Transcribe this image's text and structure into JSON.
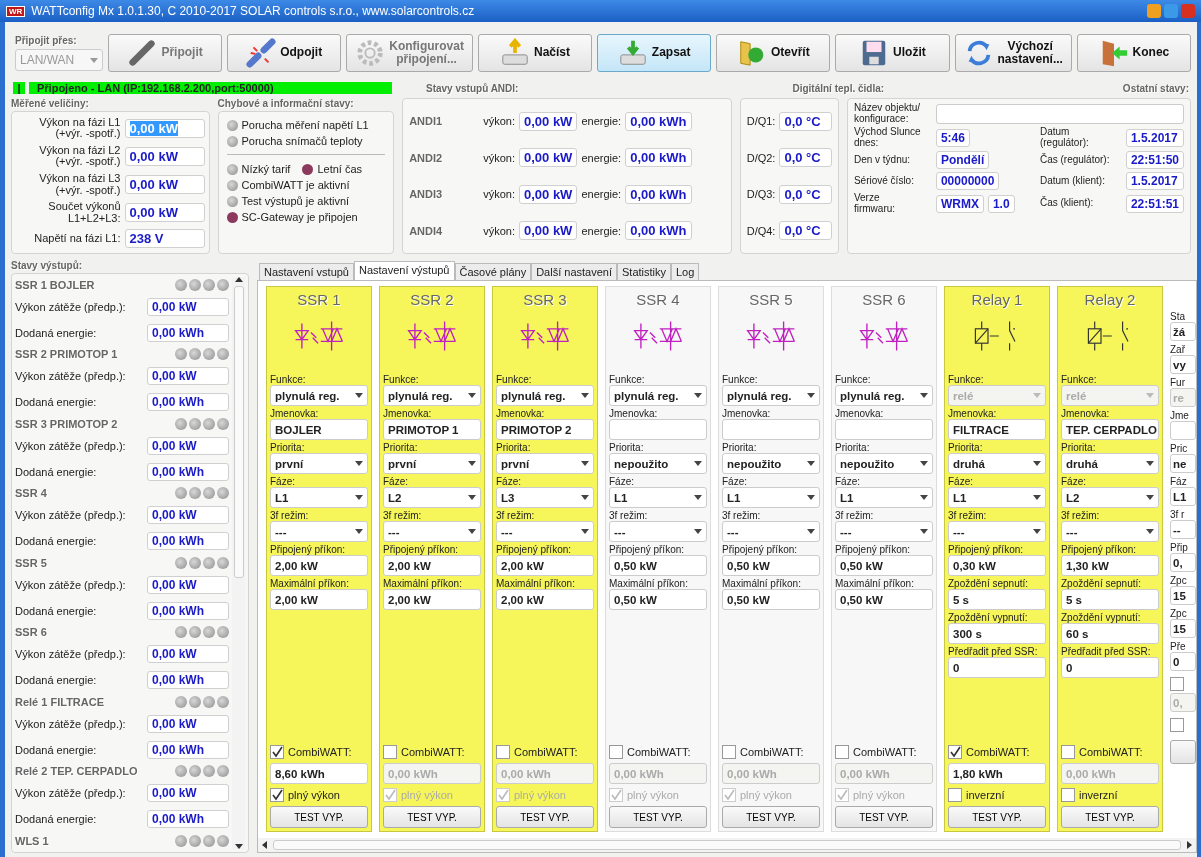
{
  "window": {
    "logo": "WR",
    "title": "WATTconfig Mx 1.0.1.30, C 2010-2017 SOLAR controls s.r.o., www.solarcontrols.cz"
  },
  "connection": {
    "label": "Připojit přes:",
    "value": "LAN/WAN",
    "disabled": true
  },
  "toolbar": [
    {
      "kind": "connect",
      "label": "Připojit",
      "disabled": true,
      "selected": false
    },
    {
      "kind": "disconnect",
      "label": "Odpojit",
      "disabled": false,
      "selected": false
    },
    {
      "kind": "configure",
      "label": "Konfigurovat\npřipojení...",
      "disabled": true,
      "selected": false
    },
    {
      "kind": "load",
      "label": "Načíst",
      "disabled": false,
      "selected": false
    },
    {
      "kind": "write",
      "label": "Zapsat",
      "disabled": false,
      "selected": true
    },
    {
      "kind": "open",
      "label": "Otevřít",
      "disabled": false,
      "selected": false
    },
    {
      "kind": "save",
      "label": "Uložit",
      "disabled": false,
      "selected": false
    },
    {
      "kind": "reset",
      "label": "Výchozí\nnastavení...",
      "disabled": false,
      "selected": false
    },
    {
      "kind": "exit",
      "label": "Konec",
      "disabled": false,
      "selected": false
    }
  ],
  "status": {
    "indicator": "|",
    "text": "Připojeno - LAN (IP:192.168.2.200,port:50000)",
    "connected": true
  },
  "measured": {
    "title": "Měřené veličiny:",
    "rows": [
      {
        "label": "Výkon na fázi L1\n(+výr. -spotř.)",
        "value": "0,00 kW",
        "selected": true
      },
      {
        "label": "Výkon na fázi L2\n(+výr. -spotř.)",
        "value": "0,00 kW",
        "selected": false
      },
      {
        "label": "Výkon na fázi L3\n(+výr. -spotř.)",
        "value": "0,00 kW",
        "selected": false
      },
      {
        "label": "Součet výkonů\nL1+L2+L3:",
        "value": "0,00 kW",
        "selected": false
      },
      {
        "label": "Napětí na fázi L1:",
        "value": "238 V",
        "selected": false
      }
    ]
  },
  "info": {
    "title": "Chybové a informační stavy:",
    "rows": [
      {
        "divider_before": false,
        "items": [
          {
            "label": "Porucha měření napětí L1",
            "on": false
          }
        ]
      },
      {
        "divider_before": false,
        "items": [
          {
            "label": "Porucha snímačů teploty",
            "on": false
          }
        ]
      },
      {
        "divider_before": true,
        "items": [
          {
            "label": "Nízký tarif",
            "on": false
          },
          {
            "label": "Letní čas",
            "on": true
          }
        ]
      },
      {
        "divider_before": false,
        "items": [
          {
            "label": "CombiWATT je aktivní",
            "on": false
          }
        ]
      },
      {
        "divider_before": false,
        "items": [
          {
            "label": "Test výstupů je aktivní",
            "on": false
          }
        ]
      },
      {
        "divider_before": false,
        "items": [
          {
            "label": "SC-Gateway je připojen",
            "on": true
          }
        ]
      }
    ]
  },
  "andi": {
    "title": "Stavy vstupů ANDI:",
    "rows": [
      {
        "name": "ANDI1",
        "power_label": "výkon:",
        "power": "0,00 kW",
        "energy_label": "energie:",
        "energy": "0,00 kWh"
      },
      {
        "name": "ANDI2",
        "power_label": "výkon:",
        "power": "0,00 kW",
        "energy_label": "energie:",
        "energy": "0,00 kWh"
      },
      {
        "name": "ANDI3",
        "power_label": "výkon:",
        "power": "0,00 kW",
        "energy_label": "energie:",
        "energy": "0,00 kWh"
      },
      {
        "name": "ANDI4",
        "power_label": "výkon:",
        "power": "0,00 kW",
        "energy_label": "energie:",
        "energy": "0,00 kWh"
      }
    ]
  },
  "temps": {
    "title": "Digitální tepl. čidla:",
    "rows": [
      {
        "label": "D/Q1:",
        "value": "0,0 °C"
      },
      {
        "label": "D/Q2:",
        "value": "0,0 °C"
      },
      {
        "label": "D/Q3:",
        "value": "0,0 °C"
      },
      {
        "label": "D/Q4:",
        "value": "0,0 °C"
      }
    ]
  },
  "other": {
    "title": "Ostatní stavy:",
    "name_label": "Název objektu/\nkonfigurace:",
    "rows": [
      {
        "left_label": "Východ Slunce\ndnes:",
        "left_values": [
          "5:46"
        ],
        "right_label": "Datum\n(regulátor):",
        "right_value": "1.5.2017"
      },
      {
        "left_label": "Den v týdnu:",
        "left_values": [
          "Pondělí"
        ],
        "right_label": "Čas (regulátor):",
        "right_value": "22:51:50"
      },
      {
        "left_label": "Sériové číslo:",
        "left_values": [
          "00000000"
        ],
        "right_label": "Datum (klient):",
        "right_value": "1.5.2017"
      },
      {
        "left_label": "Verze\nfirmwaru:",
        "left_values": [
          "WRMX",
          "1.0"
        ],
        "right_label": "Čas (klient):",
        "right_value": "22:51:51"
      }
    ]
  },
  "outputs_panel": {
    "title": "Stavy výstupů:",
    "items": [
      {
        "name": "SSR 1 BOJLER",
        "leds": [
          {
            "on": false
          },
          {
            "on": false
          },
          {
            "on": false
          },
          {
            "on": false
          }
        ],
        "rows": [
          {
            "label": "Výkon zátěže (předp.):",
            "value": "0,00 kW"
          },
          {
            "label": "Dodaná energie:",
            "value": "0,00 kWh"
          }
        ]
      },
      {
        "name": "SSR 2 PRIMOTOP 1",
        "leds": [
          {
            "on": false
          },
          {
            "on": false
          },
          {
            "on": false
          },
          {
            "on": false
          }
        ],
        "rows": [
          {
            "label": "Výkon zátěže (předp.):",
            "value": "0,00 kW"
          },
          {
            "label": "Dodaná energie:",
            "value": "0,00 kWh"
          }
        ]
      },
      {
        "name": "SSR 3 PRIMOTOP 2",
        "leds": [
          {
            "on": false
          },
          {
            "on": false
          },
          {
            "on": false
          },
          {
            "on": false
          }
        ],
        "rows": [
          {
            "label": "Výkon zátěže (předp.):",
            "value": "0,00 kW"
          },
          {
            "label": "Dodaná energie:",
            "value": "0,00 kWh"
          }
        ]
      },
      {
        "name": "SSR 4",
        "leds": [
          {
            "on": false
          },
          {
            "on": false
          },
          {
            "on": false
          },
          {
            "on": false
          }
        ],
        "rows": [
          {
            "label": "Výkon zátěže (předp.):",
            "value": "0,00 kW"
          },
          {
            "label": "Dodaná energie:",
            "value": "0,00 kWh"
          }
        ]
      },
      {
        "name": "SSR 5",
        "leds": [
          {
            "on": false
          },
          {
            "on": false
          },
          {
            "on": false
          },
          {
            "on": false
          }
        ],
        "rows": [
          {
            "label": "Výkon zátěže (předp.):",
            "value": "0,00 kW"
          },
          {
            "label": "Dodaná energie:",
            "value": "0,00 kWh"
          }
        ]
      },
      {
        "name": "SSR 6",
        "leds": [
          {
            "on": false
          },
          {
            "on": false
          },
          {
            "on": false
          },
          {
            "on": false
          }
        ],
        "rows": [
          {
            "label": "Výkon zátěže (předp.):",
            "value": "0,00 kW"
          },
          {
            "label": "Dodaná energie:",
            "value": "0,00 kWh"
          }
        ]
      },
      {
        "name": "Relé 1 FILTRACE",
        "leds": [
          {
            "on": false
          },
          {
            "on": false
          },
          {
            "on": false
          },
          {
            "on": false
          }
        ],
        "rows": [
          {
            "label": "Výkon zátěže (předp.):",
            "value": "0,00 kW"
          },
          {
            "label": "Dodaná energie:",
            "value": "0,00 kWh"
          }
        ]
      },
      {
        "name": "Relé 2 TEP. CERPADLO",
        "leds": [
          {
            "on": false
          },
          {
            "on": false
          },
          {
            "on": false
          },
          {
            "on": false
          }
        ],
        "rows": [
          {
            "label": "Výkon zátěže (předp.):",
            "value": "0,00 kW"
          },
          {
            "label": "Dodaná energie:",
            "value": "0,00 kWh"
          }
        ]
      },
      {
        "name": "WLS 1",
        "leds": [
          {
            "on": false
          },
          {
            "on": false
          },
          {
            "on": false
          },
          {
            "on": false
          }
        ]
      }
    ]
  },
  "tabs": [
    {
      "label": "Nastavení vstupů",
      "selected": false
    },
    {
      "label": "Nastavení výstupů",
      "selected": true
    },
    {
      "label": "Časové plány",
      "selected": false
    },
    {
      "label": "Další nastavení",
      "selected": false
    },
    {
      "label": "Statistiky",
      "selected": false
    },
    {
      "label": "Log",
      "selected": false
    }
  ],
  "columns": [
    {
      "title": "SSR 1",
      "kind": "ssr",
      "highlighted": true,
      "fields": [
        {
          "kind": "select",
          "label": "Funkce:",
          "value": "plynulá reg.",
          "disabled": false
        },
        {
          "kind": "input",
          "label": "Jmenovka:",
          "value": "BOJLER",
          "disabled": false
        },
        {
          "kind": "select",
          "label": "Priorita:",
          "value": "první",
          "disabled": false
        },
        {
          "kind": "select",
          "label": "Fáze:",
          "value": "L1",
          "disabled": false
        },
        {
          "kind": "select",
          "label": "3f režim:",
          "value": "---",
          "disabled": false
        },
        {
          "kind": "input",
          "label": "Připojený příkon:",
          "value": "2,00 kW",
          "disabled": false
        },
        {
          "kind": "input",
          "label": "Maximální příkon:",
          "value": "2,00 kW",
          "disabled": false
        }
      ],
      "combi": {
        "label": "CombiWATT:",
        "checked": true,
        "value": "8,60 kWh",
        "disabled": false
      },
      "option": {
        "label": "plný výkon",
        "checked": true,
        "disabled": false
      },
      "button": "TEST VYP."
    },
    {
      "title": "SSR 2",
      "kind": "ssr",
      "highlighted": true,
      "fields": [
        {
          "kind": "select",
          "label": "Funkce:",
          "value": "plynulá reg.",
          "disabled": false
        },
        {
          "kind": "input",
          "label": "Jmenovka:",
          "value": "PRIMOTOP 1",
          "disabled": false
        },
        {
          "kind": "select",
          "label": "Priorita:",
          "value": "první",
          "disabled": false
        },
        {
          "kind": "select",
          "label": "Fáze:",
          "value": "L2",
          "disabled": false
        },
        {
          "kind": "select",
          "label": "3f režim:",
          "value": "---",
          "disabled": false
        },
        {
          "kind": "input",
          "label": "Připojený příkon:",
          "value": "2,00 kW",
          "disabled": false
        },
        {
          "kind": "input",
          "label": "Maximální příkon:",
          "value": "2,00 kW",
          "disabled": false
        }
      ],
      "combi": {
        "label": "CombiWATT:",
        "checked": false,
        "value": "0,00 kWh",
        "disabled": true
      },
      "option": {
        "label": "plný výkon",
        "checked": true,
        "disabled": true
      },
      "button": "TEST VYP."
    },
    {
      "title": "SSR 3",
      "kind": "ssr",
      "highlighted": true,
      "fields": [
        {
          "kind": "select",
          "label": "Funkce:",
          "value": "plynulá reg.",
          "disabled": false
        },
        {
          "kind": "input",
          "label": "Jmenovka:",
          "value": "PRIMOTOP 2",
          "disabled": false
        },
        {
          "kind": "select",
          "label": "Priorita:",
          "value": "první",
          "disabled": false
        },
        {
          "kind": "select",
          "label": "Fáze:",
          "value": "L3",
          "disabled": false
        },
        {
          "kind": "select",
          "label": "3f režim:",
          "value": "---",
          "disabled": false
        },
        {
          "kind": "input",
          "label": "Připojený příkon:",
          "value": "2,00 kW",
          "disabled": false
        },
        {
          "kind": "input",
          "label": "Maximální příkon:",
          "value": "2,00 kW",
          "disabled": false
        }
      ],
      "combi": {
        "label": "CombiWATT:",
        "checked": false,
        "value": "0,00 kWh",
        "disabled": true
      },
      "option": {
        "label": "plný výkon",
        "checked": true,
        "disabled": true
      },
      "button": "TEST VYP."
    },
    {
      "title": "SSR 4",
      "kind": "ssr",
      "highlighted": false,
      "fields": [
        {
          "kind": "select",
          "label": "Funkce:",
          "value": "plynulá reg.",
          "disabled": false
        },
        {
          "kind": "input",
          "label": "Jmenovka:",
          "disabled": false
        },
        {
          "kind": "select",
          "label": "Priorita:",
          "value": "nepoužito",
          "disabled": false
        },
        {
          "kind": "select",
          "label": "Fáze:",
          "value": "L1",
          "disabled": false
        },
        {
          "kind": "select",
          "label": "3f režim:",
          "value": "---",
          "disabled": false
        },
        {
          "kind": "input",
          "label": "Připojený příkon:",
          "value": "0,50 kW",
          "disabled": false
        },
        {
          "kind": "input",
          "label": "Maximální příkon:",
          "value": "0,50 kW",
          "disabled": false
        }
      ],
      "combi": {
        "label": "CombiWATT:",
        "checked": false,
        "value": "0,00 kWh",
        "disabled": true
      },
      "option": {
        "label": "plný výkon",
        "checked": true,
        "disabled": true
      },
      "button": "TEST VYP."
    },
    {
      "title": "SSR 5",
      "kind": "ssr",
      "highlighted": false,
      "fields": [
        {
          "kind": "select",
          "label": "Funkce:",
          "value": "plynulá reg.",
          "disabled": false
        },
        {
          "kind": "input",
          "label": "Jmenovka:",
          "disabled": false
        },
        {
          "kind": "select",
          "label": "Priorita:",
          "value": "nepoužito",
          "disabled": false
        },
        {
          "kind": "select",
          "label": "Fáze:",
          "value": "L1",
          "disabled": false
        },
        {
          "kind": "select",
          "label": "3f režim:",
          "value": "---",
          "disabled": false
        },
        {
          "kind": "input",
          "label": "Připojený příkon:",
          "value": "0,50 kW",
          "disabled": false
        },
        {
          "kind": "input",
          "label": "Maximální příkon:",
          "value": "0,50 kW",
          "disabled": false
        }
      ],
      "combi": {
        "label": "CombiWATT:",
        "checked": false,
        "value": "0,00 kWh",
        "disabled": true
      },
      "option": {
        "label": "plný výkon",
        "checked": true,
        "disabled": true
      },
      "button": "TEST VYP."
    },
    {
      "title": "SSR 6",
      "kind": "ssr",
      "highlighted": false,
      "fields": [
        {
          "kind": "select",
          "label": "Funkce:",
          "value": "plynulá reg.",
          "disabled": false
        },
        {
          "kind": "input",
          "label": "Jmenovka:",
          "disabled": false
        },
        {
          "kind": "select",
          "label": "Priorita:",
          "value": "nepoužito",
          "disabled": false
        },
        {
          "kind": "select",
          "label": "Fáze:",
          "value": "L1",
          "disabled": false
        },
        {
          "kind": "select",
          "label": "3f režim:",
          "value": "---",
          "disabled": false
        },
        {
          "kind": "input",
          "label": "Připojený příkon:",
          "value": "0,50 kW",
          "disabled": false
        },
        {
          "kind": "input",
          "label": "Maximální příkon:",
          "value": "0,50 kW",
          "disabled": false
        }
      ],
      "combi": {
        "label": "CombiWATT:",
        "checked": false,
        "value": "0,00 kWh",
        "disabled": true
      },
      "option": {
        "label": "plný výkon",
        "checked": true,
        "disabled": true
      },
      "button": "TEST VYP."
    },
    {
      "title": "Relay 1",
      "kind": "relay",
      "highlighted": true,
      "fields": [
        {
          "kind": "select",
          "label": "Funkce:",
          "value": "relé",
          "disabled": true
        },
        {
          "kind": "input",
          "label": "Jmenovka:",
          "value": "FILTRACE",
          "disabled": false
        },
        {
          "kind": "select",
          "label": "Priorita:",
          "value": "druhá",
          "disabled": false
        },
        {
          "kind": "select",
          "label": "Fáze:",
          "value": "L1",
          "disabled": false
        },
        {
          "kind": "select",
          "label": "3f režim:",
          "value": "---",
          "disabled": false
        },
        {
          "kind": "input",
          "label": "Připojený příkon:",
          "value": "0,30 kW",
          "disabled": false
        },
        {
          "kind": "input",
          "label": "Zpoždění sepnutí:",
          "value": "5 s",
          "disabled": false
        },
        {
          "kind": "input",
          "label": "Zpoždění vypnutí:",
          "value": "300 s",
          "disabled": false
        },
        {
          "kind": "input",
          "label": "Předřadit před SSR:",
          "value": "0",
          "disabled": false
        }
      ],
      "combi": {
        "label": "CombiWATT:",
        "checked": true,
        "value": "1,80 kWh",
        "disabled": false
      },
      "option": {
        "label": "inverzní",
        "checked": false,
        "disabled": false
      },
      "button": "TEST VYP."
    },
    {
      "title": "Relay 2",
      "kind": "relay",
      "highlighted": true,
      "fields": [
        {
          "kind": "select",
          "label": "Funkce:",
          "value": "relé",
          "disabled": true
        },
        {
          "kind": "input",
          "label": "Jmenovka:",
          "value": "TEP. CERPADLO",
          "disabled": false
        },
        {
          "kind": "select",
          "label": "Priorita:",
          "value": "druhá",
          "disabled": false
        },
        {
          "kind": "select",
          "label": "Fáze:",
          "value": "L2",
          "disabled": false
        },
        {
          "kind": "select",
          "label": "3f režim:",
          "value": "---",
          "disabled": false
        },
        {
          "kind": "input",
          "label": "Připojený příkon:",
          "value": "1,30 kW",
          "disabled": false
        },
        {
          "kind": "input",
          "label": "Zpoždění sepnutí:",
          "value": "5 s",
          "disabled": false
        },
        {
          "kind": "input",
          "label": "Zpoždění vypnutí:",
          "value": "60 s",
          "disabled": false
        },
        {
          "kind": "input",
          "label": "Předřadit před SSR:",
          "value": "0",
          "disabled": false
        }
      ],
      "combi": {
        "label": "CombiWATT:",
        "checked": false,
        "value": "0,00 kWh",
        "disabled": true
      },
      "option": {
        "label": "inverzní",
        "checked": false,
        "disabled": false
      },
      "button": "TEST VYP."
    }
  ],
  "partial_column": {
    "items": [
      {
        "kind": "label",
        "text": "Sta"
      },
      {
        "kind": "field",
        "text": "žá",
        "disabled": false
      },
      {
        "kind": "label",
        "text": "Zař"
      },
      {
        "kind": "field",
        "text": "vy",
        "disabled": false
      },
      {
        "kind": "label",
        "text": "Fur"
      },
      {
        "kind": "field",
        "text": "re",
        "disabled": true
      },
      {
        "kind": "label",
        "text": "Jme"
      },
      {
        "kind": "field",
        "disabled": false
      },
      {
        "kind": "label",
        "text": "Pric"
      },
      {
        "kind": "field",
        "text": "ne",
        "disabled": false
      },
      {
        "kind": "label",
        "text": "Fáz"
      },
      {
        "kind": "field",
        "text": "L1",
        "disabled": false
      },
      {
        "kind": "label",
        "text": "3f r"
      },
      {
        "kind": "field",
        "text": "--",
        "disabled": false
      },
      {
        "kind": "label",
        "text": "Přip"
      },
      {
        "kind": "field",
        "text": "0,",
        "disabled": false
      },
      {
        "kind": "label",
        "text": "Zpc"
      },
      {
        "kind": "field",
        "text": "15",
        "disabled": false
      },
      {
        "kind": "label",
        "text": "Zpc"
      },
      {
        "kind": "field",
        "text": "15",
        "disabled": false
      },
      {
        "kind": "label",
        "text": "Pře"
      },
      {
        "kind": "field",
        "text": "0",
        "disabled": false
      },
      {
        "kind": "check",
        "checked": false
      },
      {
        "kind": "field",
        "text": "0,",
        "disabled": true
      },
      {
        "kind": "check",
        "checked": false
      },
      {
        "kind": "button"
      }
    ]
  }
}
